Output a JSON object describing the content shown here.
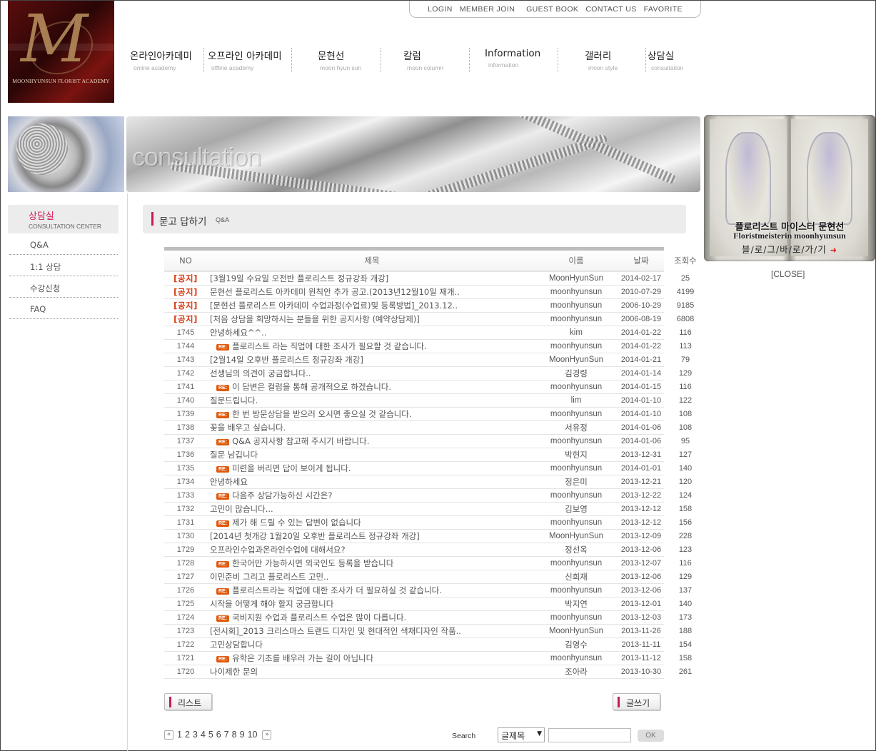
{
  "logo": {
    "letter": "M",
    "text": "MOONHYUNSUN FLORIST ACADEMY"
  },
  "toplinks": [
    "LOGIN",
    "MEMBER JOIN",
    "GUEST BOOK",
    "CONTACT US",
    "FAVORITE"
  ],
  "gnb": [
    {
      "ko": "온라인아카데미",
      "en": "online academy"
    },
    {
      "ko": "오프라인 아카데미",
      "en": "offline academy"
    },
    {
      "ko": "문현선",
      "en": "moon hyun sun"
    },
    {
      "ko": "칼럼",
      "en": "moon column"
    },
    {
      "ko": "Information",
      "en": "information"
    },
    {
      "ko": "갤러리",
      "en": "moon style"
    },
    {
      "ko": "상담실",
      "en": "consultation"
    }
  ],
  "banner": {
    "caption": "consultation"
  },
  "book": {
    "line1": "플로리스트 마이스터 문현선",
    "line2": "Floristmeisterin moonhyunsun",
    "line3": "블/로/그/바/로/가/기",
    "close": "[CLOSE]"
  },
  "snb": {
    "title_ko": "상담실",
    "title_en": "CONSULTATION CENTER",
    "items": [
      "Q&A",
      "1:1 상담",
      "수강신청",
      "FAQ"
    ]
  },
  "page": {
    "title": "묻고 답하기",
    "subtitle": "Q&A"
  },
  "board": {
    "headers": {
      "no": "NO",
      "subject": "제목",
      "name": "이름",
      "date": "날짜",
      "hits": "조회수"
    },
    "rows": [
      {
        "no": "[공지]",
        "notice": true,
        "re": false,
        "subject": "[3월19일 수요일 오전반 플로리스트 정규강좌 개강]",
        "name": "MoonHyunSun",
        "date": "2014-02-17",
        "hits": "25"
      },
      {
        "no": "[공지]",
        "notice": true,
        "re": false,
        "subject": "문현선 플로리스트 아카데미 원칙안 추가 공고.(2013년12월10일 재개..",
        "name": "moonhyunsun",
        "date": "2010-07-29",
        "hits": "4199"
      },
      {
        "no": "[공지]",
        "notice": true,
        "re": false,
        "subject": "[문현선 플로리스트 아카데미 수업과정(수업료)및 등록방법]_2013.12..",
        "name": "moonhyunsun",
        "date": "2006-10-29",
        "hits": "9185"
      },
      {
        "no": "[공지]",
        "notice": true,
        "re": false,
        "subject": "[처음 상담을 희망하시는 분들을 위한 공지사항 (예약상담제)]",
        "name": "moonhyunsun",
        "date": "2006-08-19",
        "hits": "6808"
      },
      {
        "no": "1745",
        "notice": false,
        "re": false,
        "subject": "안녕하세요^^..",
        "name": "kim",
        "date": "2014-01-22",
        "hits": "116"
      },
      {
        "no": "1744",
        "notice": false,
        "re": true,
        "subject": "플로리스트 라는 직업에 대한 조사가 필요할 것 같습니다.",
        "name": "moonhyunsun",
        "date": "2014-01-22",
        "hits": "113"
      },
      {
        "no": "1743",
        "notice": false,
        "re": false,
        "subject": "[2월14일 오후반 플로리스트 정규강좌 개강]",
        "name": "MoonHyunSun",
        "date": "2014-01-21",
        "hits": "79"
      },
      {
        "no": "1742",
        "notice": false,
        "re": false,
        "subject": "선생님의 의견이 궁금합니다..",
        "name": "김경령",
        "date": "2014-01-14",
        "hits": "129"
      },
      {
        "no": "1741",
        "notice": false,
        "re": true,
        "subject": "이 답변은 컬럼을 통해 공개적으로 하겠습니다.",
        "name": "moonhyunsun",
        "date": "2014-01-15",
        "hits": "116"
      },
      {
        "no": "1740",
        "notice": false,
        "re": false,
        "subject": "질문드립니다.",
        "name": "lim",
        "date": "2014-01-10",
        "hits": "122"
      },
      {
        "no": "1739",
        "notice": false,
        "re": true,
        "subject": "한 번 방문상담을 받으러 오시면 좋으실 것 같습니다.",
        "name": "moonhyunsun",
        "date": "2014-01-10",
        "hits": "108"
      },
      {
        "no": "1738",
        "notice": false,
        "re": false,
        "subject": "꽃을 배우고 싶습니다.",
        "name": "서유정",
        "date": "2014-01-06",
        "hits": "108"
      },
      {
        "no": "1737",
        "notice": false,
        "re": true,
        "subject": "Q&A 공지사항 참고해 주시기 바랍니다.",
        "name": "moonhyunsun",
        "date": "2014-01-06",
        "hits": "95"
      },
      {
        "no": "1736",
        "notice": false,
        "re": false,
        "subject": "질문 남깁니다",
        "name": "박현지",
        "date": "2013-12-31",
        "hits": "127"
      },
      {
        "no": "1735",
        "notice": false,
        "re": true,
        "subject": "미련을 버리면 답이 보이게 됩니다.",
        "name": "moonhyunsun",
        "date": "2014-01-01",
        "hits": "140"
      },
      {
        "no": "1734",
        "notice": false,
        "re": false,
        "subject": "안녕하세요",
        "name": "정은미",
        "date": "2013-12-21",
        "hits": "120"
      },
      {
        "no": "1733",
        "notice": false,
        "re": true,
        "subject": "다음주 상담가능하신 시간은?",
        "name": "moonhyunsun",
        "date": "2013-12-22",
        "hits": "124"
      },
      {
        "no": "1732",
        "notice": false,
        "re": false,
        "subject": "고민이 많습니다...",
        "name": "김보영",
        "date": "2013-12-12",
        "hits": "158"
      },
      {
        "no": "1731",
        "notice": false,
        "re": true,
        "subject": "제가 해 드릴 수 있는 답변이 없습니다",
        "name": "moonhyunsun",
        "date": "2013-12-12",
        "hits": "156"
      },
      {
        "no": "1730",
        "notice": false,
        "re": false,
        "subject": "[2014년 첫개강 1월20일 오후반 플로리스트 정규강좌 개강]",
        "name": "MoonHyunSun",
        "date": "2013-12-09",
        "hits": "228"
      },
      {
        "no": "1729",
        "notice": false,
        "re": false,
        "subject": "오프라인수업과온라인수업에 대해서요?",
        "name": "정선옥",
        "date": "2013-12-06",
        "hits": "123"
      },
      {
        "no": "1728",
        "notice": false,
        "re": true,
        "subject": "한국어만 가능하시면 외국인도 등록을 받습니다",
        "name": "moonhyunsun",
        "date": "2013-12-07",
        "hits": "116"
      },
      {
        "no": "1727",
        "notice": false,
        "re": false,
        "subject": "이민준비 그리고 플로리스트 고민..",
        "name": "신희재",
        "date": "2013-12-06",
        "hits": "129"
      },
      {
        "no": "1726",
        "notice": false,
        "re": true,
        "subject": "플로리스트라는 직업에 대한 조사가 더 필요하실 것 같습니다.",
        "name": "moonhyunsun",
        "date": "2013-12-06",
        "hits": "137"
      },
      {
        "no": "1725",
        "notice": false,
        "re": false,
        "subject": "시작을 어떻게 해야 할지 궁금합니다",
        "name": "박지연",
        "date": "2013-12-01",
        "hits": "140"
      },
      {
        "no": "1724",
        "notice": false,
        "re": true,
        "subject": "국비지원 수업과 플로리스트 수업은 많이 다릅니다.",
        "name": "moonhyunsun",
        "date": "2013-12-03",
        "hits": "173"
      },
      {
        "no": "1723",
        "notice": false,
        "re": false,
        "subject": "[전시회]_2013 크리스마스 트랜드 디자인 및 현대적인 색채디자인 작품..",
        "name": "MoonHyunSun",
        "date": "2013-11-26",
        "hits": "188"
      },
      {
        "no": "1722",
        "notice": false,
        "re": false,
        "subject": "고민상담합니다",
        "name": "김영수",
        "date": "2013-11-11",
        "hits": "154"
      },
      {
        "no": "1721",
        "notice": false,
        "re": true,
        "subject": "유학은 기초를 배우러 가는 길이 아닙니다",
        "name": "moonhyunsun",
        "date": "2013-11-12",
        "hits": "158"
      },
      {
        "no": "1720",
        "notice": false,
        "re": false,
        "subject": "나이제한 문의",
        "name": "조아라",
        "date": "2013-10-30",
        "hits": "261"
      }
    ],
    "re_badge": "RE:"
  },
  "buttons": {
    "list": "리스트",
    "write": "글쓰기"
  },
  "pager": {
    "prev": "«",
    "next": "»",
    "pages": [
      "1",
      "2",
      "3",
      "4",
      "5",
      "6",
      "7",
      "8",
      "9",
      "10"
    ]
  },
  "search": {
    "label": "Search",
    "select": "글제목",
    "button": "OK",
    "value": ""
  },
  "colors": {
    "accent": "#c8195a",
    "notice": "#d23b12",
    "re_badge": "#e05a0c"
  }
}
